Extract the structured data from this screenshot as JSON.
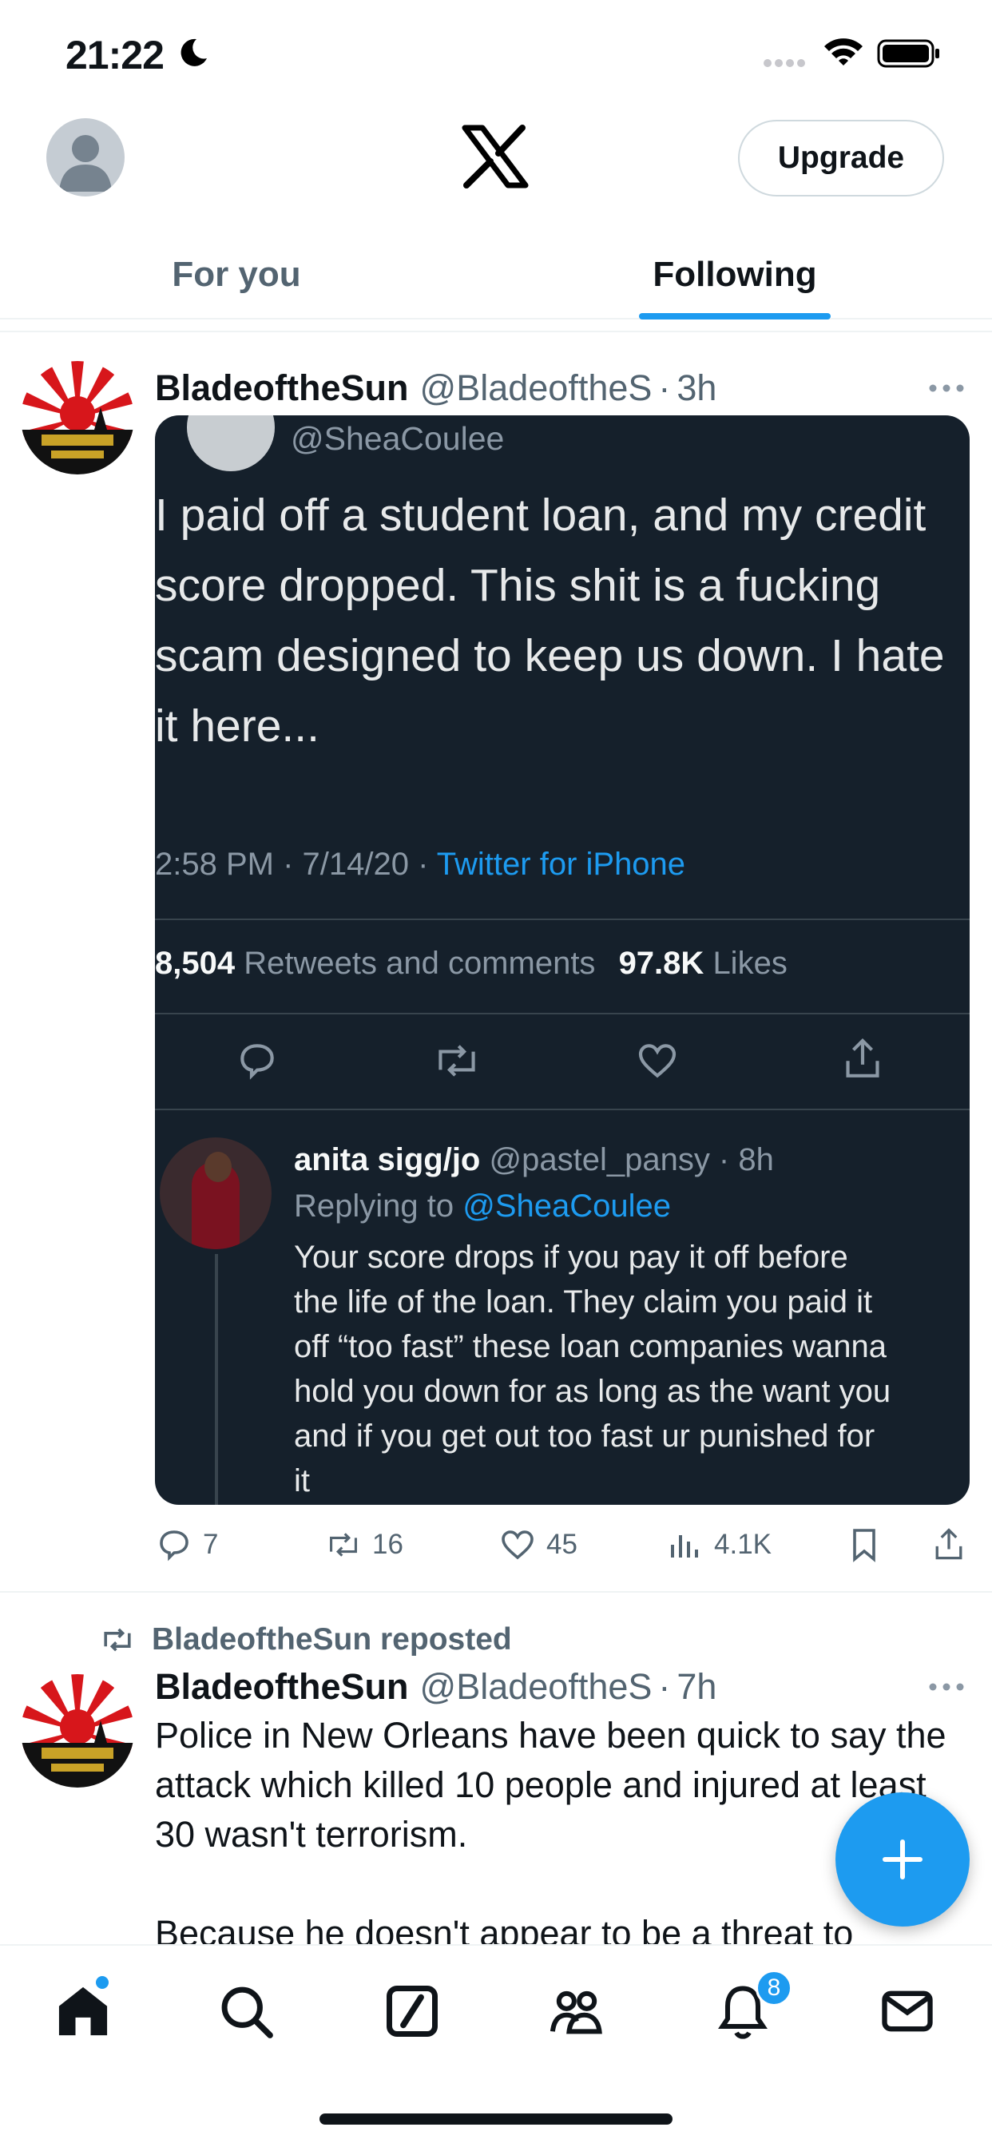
{
  "status_bar": {
    "time": "21:22"
  },
  "header": {
    "upgrade_label": "Upgrade",
    "tabs": [
      {
        "label": "For you",
        "active": false
      },
      {
        "label": "Following",
        "active": true
      }
    ]
  },
  "posts": [
    {
      "author_name": "BladeoftheSun",
      "author_handle": "@BladeoftheS",
      "dot": "·",
      "time": "3h",
      "media": {
        "handle": "@SheaCoulee",
        "text_lines": [
          "I paid off a student loan, and my credit",
          "score dropped. This shit is a fucking",
          "scam designed to keep us down. I hate",
          "it here..."
        ],
        "meta_time": "2:58 PM · 7/14/20 ·",
        "meta_source": "Twitter for iPhone",
        "retweets_count": "8,504",
        "retweets_label": "Retweets and comments",
        "likes_count": "97.8K",
        "likes_label": "Likes",
        "reply": {
          "name": "anita sigg/jo",
          "handle_time": "@pastel_pansy · 8h",
          "replying_label": "Replying to",
          "replying_handle": "@SheaCoulee",
          "text_lines": [
            "Your score drops if you pay it off before",
            "the life of the loan. They claim you paid it",
            "off “too fast” these loan companies wanna",
            "hold you down for as long as the want you",
            "and if you get out too fast ur punished for",
            "it"
          ]
        }
      },
      "actions": {
        "replies": "7",
        "reposts": "16",
        "likes": "45",
        "views": "4.1K"
      }
    },
    {
      "repost_label": "BladeoftheSun reposted",
      "author_name": "BladeoftheSun",
      "author_handle": "@BladeoftheS",
      "dot": "·",
      "time": "7h",
      "text": "Police in New Orleans have been quick to say the attack which killed 10 people and injured at least 30 wasn't terrorism.",
      "text_more": "Because he doesn't appear to be a threat to"
    }
  ],
  "bottom_nav": {
    "notifications_badge": "8"
  },
  "colors": {
    "accent": "#1d9bf0",
    "text": "#0f1419",
    "secondary": "#536471",
    "media_bg": "#15202b"
  }
}
